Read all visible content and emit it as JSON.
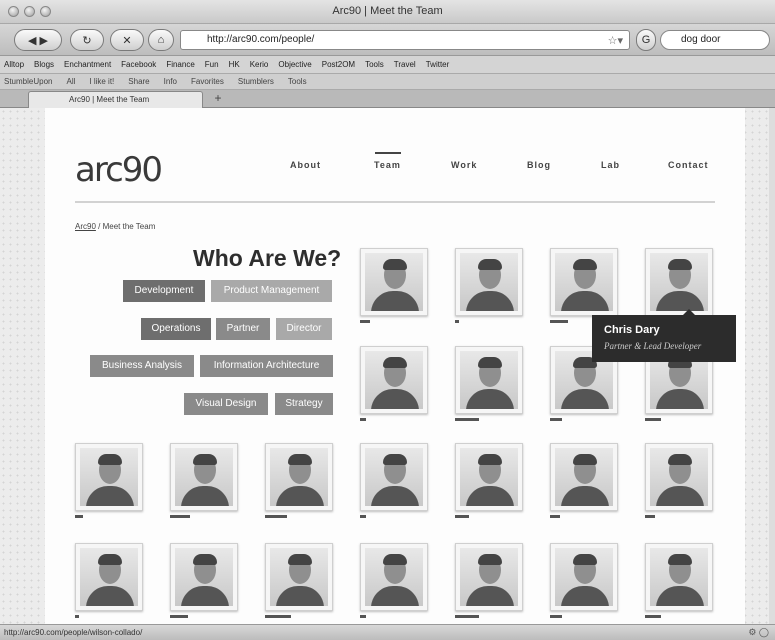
{
  "window": {
    "title": "Arc90 | Meet the Team"
  },
  "navbar": {
    "url": "http://arc90.com/people/",
    "search_value": "dog door"
  },
  "bookmarks": [
    "Alltop",
    "Blogs",
    "Enchantment",
    "Facebook",
    "Finance",
    "Fun",
    "HK",
    "Kerio",
    "Objective",
    "Post2OM",
    "Tools",
    "Travel",
    "Twitter"
  ],
  "toolbar2": [
    "StumbleUpon",
    "All",
    "I like it!",
    "Share",
    "Info",
    "Favorites",
    "Stumblers",
    "Tools"
  ],
  "tab": {
    "label": "Arc90 | Meet the Team"
  },
  "site": {
    "logo": "arc90",
    "nav": [
      "About",
      "Team",
      "Work",
      "Blog",
      "Lab",
      "Contact"
    ],
    "breadcrumb_home": "Arc90",
    "breadcrumb_current": "/ Meet the Team",
    "heading": "Who Are We?",
    "tags": [
      "Development",
      "Product Management",
      "Operations",
      "Partner",
      "Director",
      "Business Analysis",
      "Information Architecture",
      "Visual Design",
      "Strategy"
    ]
  },
  "tooltip": {
    "name": "Chris Dary",
    "role": "Partner & Lead Developer"
  },
  "statusbar": {
    "text": "http://arc90.com/people/wilson-collado/"
  },
  "colors": {
    "tag_dark": "#6e6e6e",
    "tag_mid": "#8a8a8a",
    "tag_light": "#a9a9a9",
    "tooltip_bg": "#2c2c2c"
  }
}
